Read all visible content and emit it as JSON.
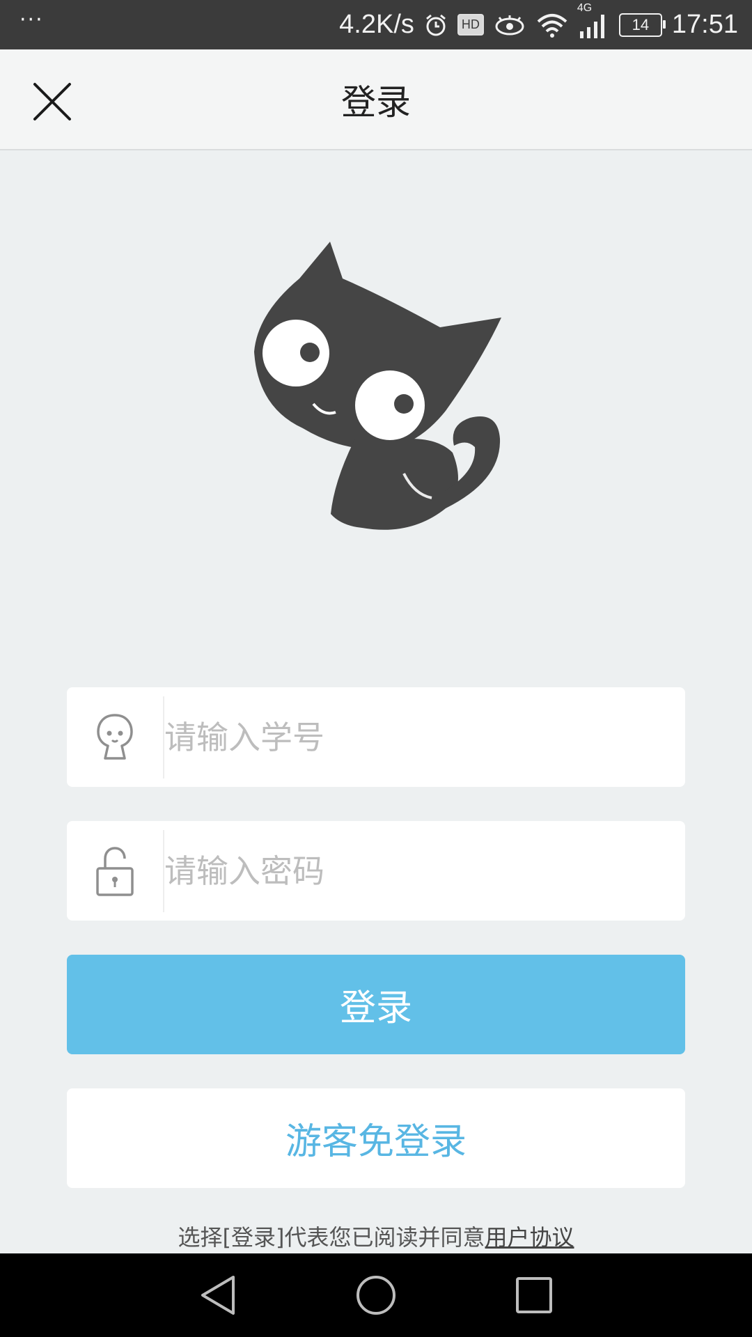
{
  "status_bar": {
    "left_indicator": "···",
    "network_speed": "4.2K/s",
    "hd_label": "HD",
    "network_type": "4G",
    "battery_level": "14",
    "time": "17:51",
    "icons": [
      "alarm-icon",
      "hd-icon",
      "eye-icon",
      "wifi-icon",
      "signal-icon",
      "battery-icon"
    ]
  },
  "header": {
    "title": "登录",
    "close_icon": "close-icon"
  },
  "mascot": {
    "icon": "cat-mascot-icon",
    "color": "#454545"
  },
  "form": {
    "student_id": {
      "placeholder": "请输入学号",
      "value": "",
      "icon": "user-icon"
    },
    "password": {
      "placeholder": "请输入密码",
      "value": "",
      "icon": "unlock-icon"
    }
  },
  "buttons": {
    "login_label": "登录",
    "guest_label": "游客免登录"
  },
  "agreement": {
    "text": "选择[登录]代表您已阅读并同意",
    "link": "用户协议"
  },
  "colors": {
    "accent": "#62c0e8",
    "accent_text": "#58b6e3",
    "background": "#edf0f1",
    "status_bar": "#3b3b3b"
  },
  "nav_bar": {
    "icons": [
      "back-icon",
      "home-icon",
      "recents-icon"
    ]
  }
}
